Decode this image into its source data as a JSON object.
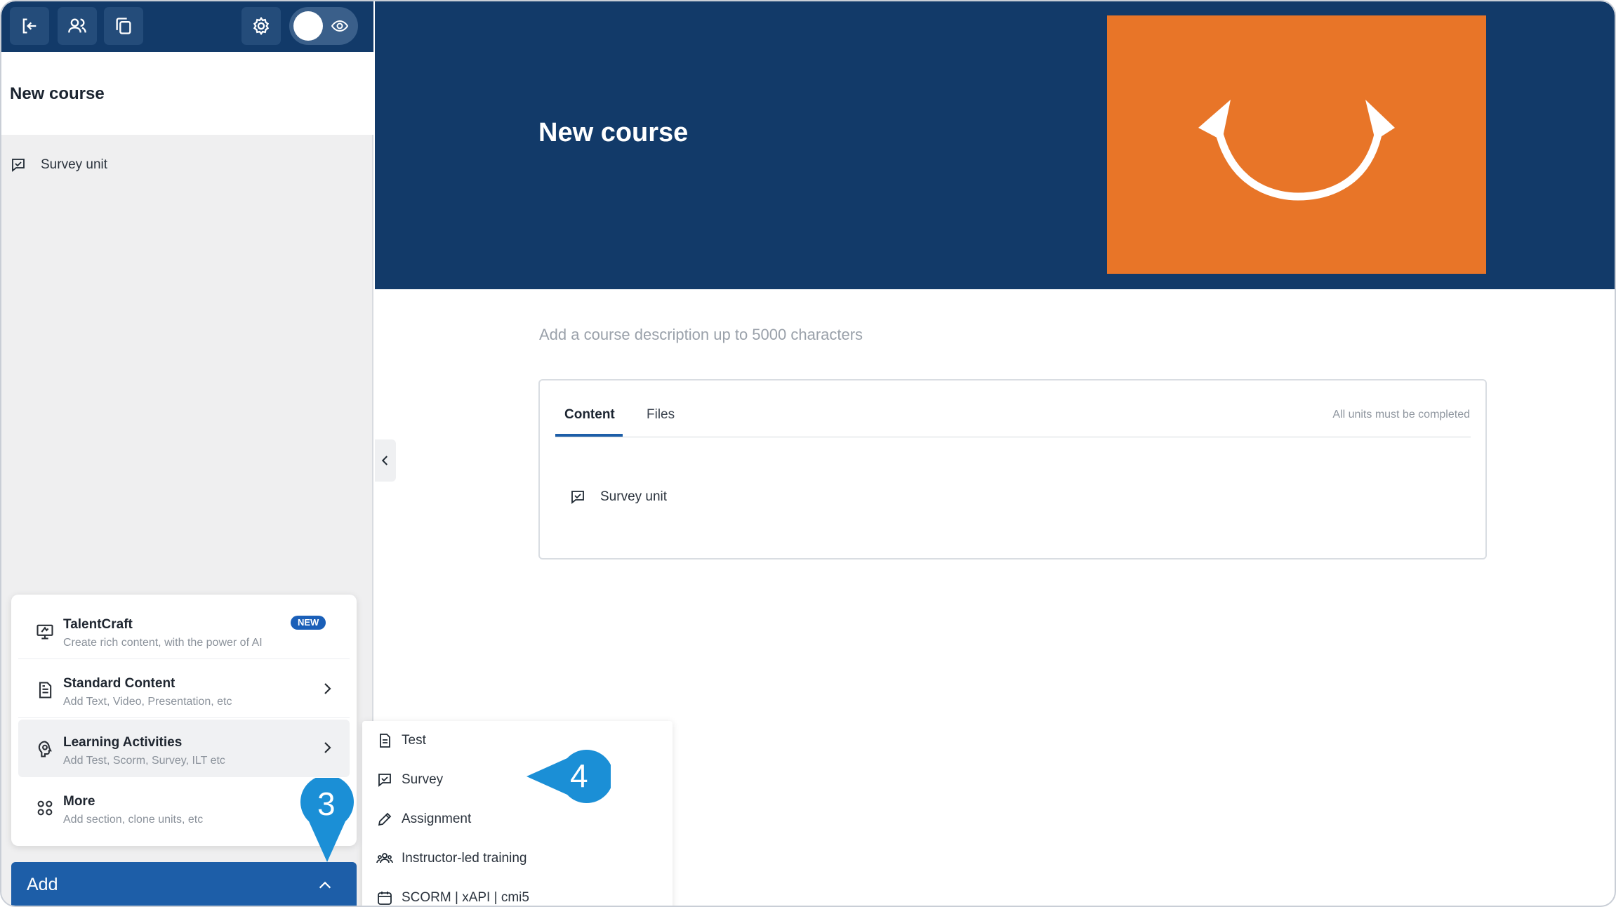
{
  "topbar": {
    "icons": [
      "exit-icon",
      "users-icon",
      "copy-icon",
      "gear-icon",
      "eye-icon"
    ]
  },
  "sidebar": {
    "course_title": "New course",
    "units": [
      {
        "label": "Survey unit",
        "icon": "survey-icon"
      }
    ]
  },
  "add_menu": {
    "items": [
      {
        "label": "TalentCraft",
        "sub": "Create rich content, with the power of AI",
        "badge": "NEW",
        "icon": "ai-icon"
      },
      {
        "label": "Standard Content",
        "sub": "Add Text, Video, Presentation, etc",
        "icon": "document-icon"
      },
      {
        "label": "Learning Activities",
        "sub": "Add Test, Scorm, Survey, ILT etc",
        "icon": "activity-icon"
      },
      {
        "label": "More",
        "sub": "Add section, clone units, etc",
        "icon": "grid-icon"
      }
    ],
    "add_label": "Add"
  },
  "hero": {
    "title": "New course",
    "image_color": "#e87528"
  },
  "main": {
    "description_placeholder": "Add a course description up to 5000 characters",
    "tabs": [
      {
        "label": "Content"
      },
      {
        "label": "Files"
      }
    ],
    "completion_rule": "All units must be completed",
    "units": [
      {
        "label": "Survey unit",
        "icon": "survey-icon"
      }
    ]
  },
  "submenu": {
    "items": [
      {
        "label": "Test",
        "icon": "test-icon"
      },
      {
        "label": "Survey",
        "icon": "survey-icon"
      },
      {
        "label": "Assignment",
        "icon": "pencil-icon"
      },
      {
        "label": "Instructor-led training",
        "icon": "group-icon"
      },
      {
        "label": "SCORM | xAPI | cmi5",
        "icon": "package-icon"
      }
    ]
  },
  "callouts": {
    "step3": "3",
    "step4": "4",
    "color": "#1b8fd6"
  },
  "colors": {
    "brand_navy": "#123a69",
    "accent_blue": "#1d5ea8",
    "hero_orange": "#e87528"
  }
}
